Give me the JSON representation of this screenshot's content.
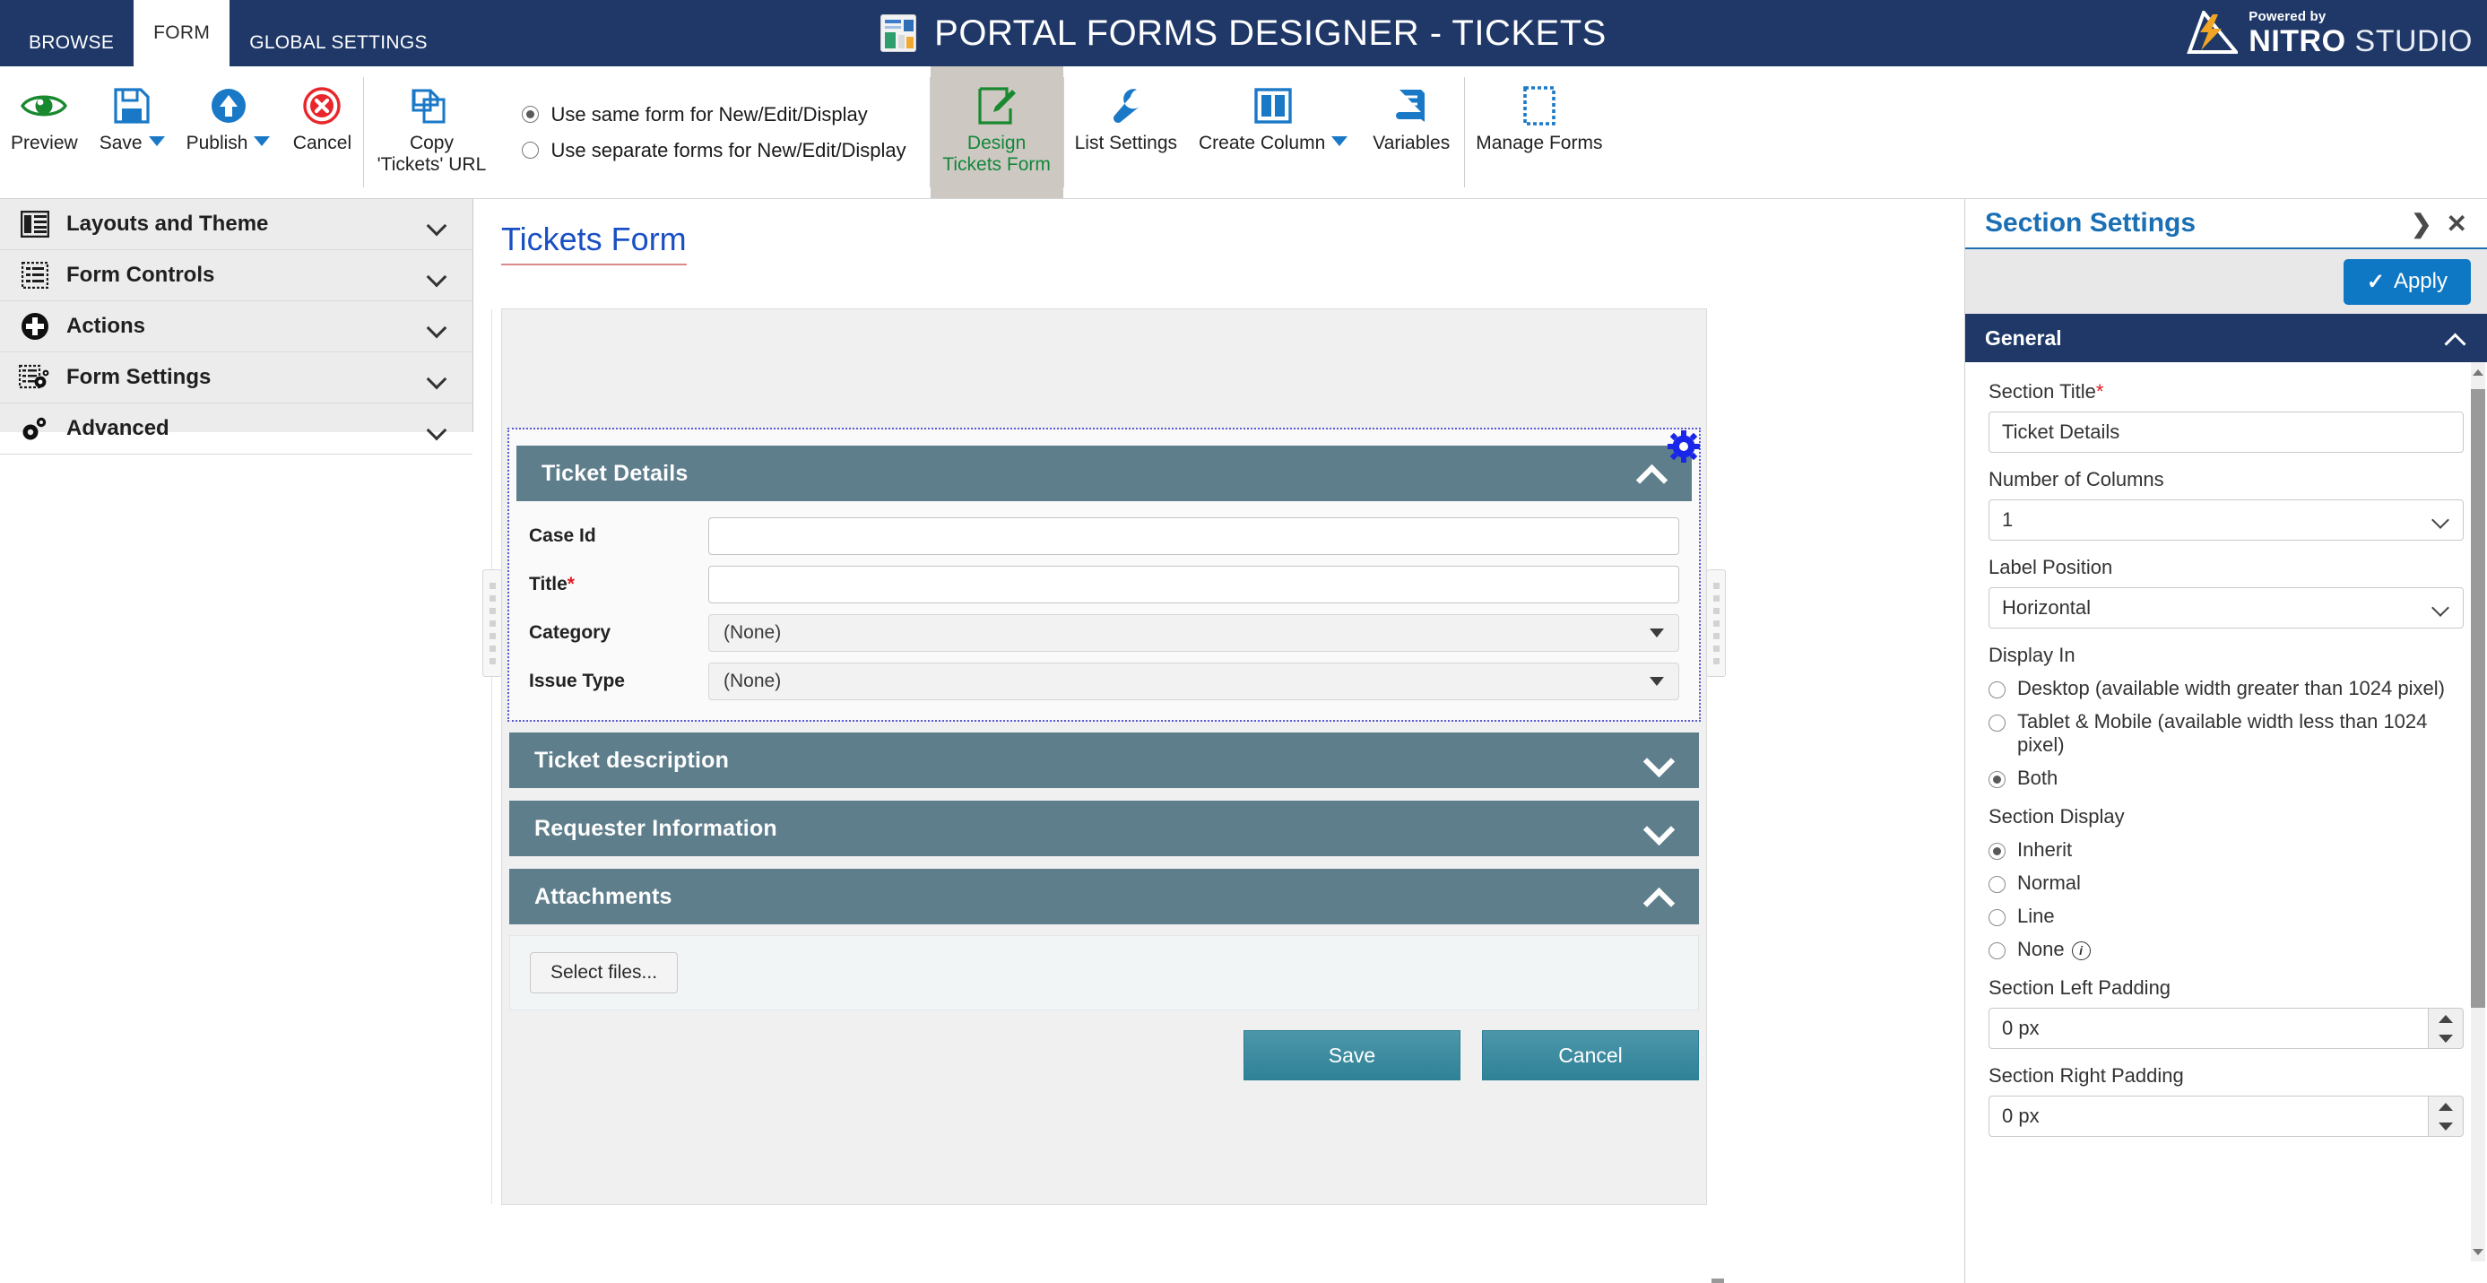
{
  "titlebar": {
    "tabs": [
      {
        "label": "BROWSE",
        "active": false
      },
      {
        "label": "FORM",
        "active": true
      },
      {
        "label": "GLOBAL SETTINGS",
        "active": false
      }
    ],
    "app_title": "PORTAL FORMS DESIGNER - TICKETS",
    "app_icon": "portal-forms-icon",
    "brand": {
      "powered_by": "Powered by",
      "name_bold": "NITRO",
      "name_light": "STUDIO",
      "accent": "#f2a524"
    },
    "bg_color": "#1f3868"
  },
  "ribbon": {
    "buttons": [
      {
        "label": "Preview",
        "icon": "eye-icon",
        "caret": false,
        "selected": false
      },
      {
        "label": "Save",
        "icon": "floppy-disk-icon",
        "caret": true,
        "selected": false
      },
      {
        "label": "Publish",
        "icon": "publish-up-arrow-icon",
        "caret": true,
        "selected": false
      },
      {
        "label": "Cancel",
        "icon": "cancel-circle-icon",
        "caret": false,
        "selected": false
      }
    ],
    "copy_url": {
      "icon": "copy-pages-icon",
      "line1": "Copy",
      "line2": "'Tickets' URL"
    },
    "form_mode": {
      "options": [
        {
          "label": "Use same form for New/Edit/Display",
          "checked": true
        },
        {
          "label": "Use separate forms for New/Edit/Display",
          "checked": false
        }
      ]
    },
    "design_button": {
      "icon": "design-pencil-icon",
      "line1": "Design",
      "line2": "Tickets Form",
      "selected": true
    },
    "tools": [
      {
        "label": "List Settings",
        "icon": "wrench-icon",
        "caret": false
      },
      {
        "label": "Create Column",
        "icon": "two-columns-icon",
        "caret": true
      },
      {
        "label": "Variables",
        "icon": "book-icon",
        "caret": false
      }
    ],
    "manage_forms": {
      "label": "Manage Forms",
      "icon": "dashed-rectangle-icon"
    }
  },
  "sidebar": {
    "items": [
      {
        "label": "Layouts and Theme",
        "icon": "layouts-icon"
      },
      {
        "label": "Form Controls",
        "icon": "form-controls-icon"
      },
      {
        "label": "Actions",
        "icon": "plus-circle-icon"
      },
      {
        "label": "Form Settings",
        "icon": "form-settings-gear-icon"
      },
      {
        "label": "Advanced",
        "icon": "advanced-gears-icon"
      }
    ]
  },
  "canvas": {
    "title": "Tickets Form",
    "sections": [
      {
        "title": "Ticket Details",
        "expanded": true,
        "selected": true,
        "gear": "section-settings-gear-icon",
        "fields": [
          {
            "label": "Case Id",
            "required": false,
            "type": "text",
            "value": ""
          },
          {
            "label": "Title",
            "required": true,
            "type": "text",
            "value": ""
          },
          {
            "label": "Category",
            "required": false,
            "type": "select",
            "value": "(None)"
          },
          {
            "label": "Issue Type",
            "required": false,
            "type": "select",
            "value": "(None)"
          }
        ]
      },
      {
        "title": "Ticket description",
        "expanded": false,
        "selected": false,
        "fields": []
      },
      {
        "title": "Requester Information",
        "expanded": false,
        "selected": false,
        "fields": []
      },
      {
        "title": "Attachments",
        "expanded": true,
        "selected": false,
        "fields": [],
        "select_files_label": "Select files..."
      }
    ],
    "actions": [
      {
        "label": "Save",
        "style": "teal"
      },
      {
        "label": "Cancel",
        "style": "teal"
      }
    ],
    "section_header_color": "#5e7e8c",
    "action_button_color": "#3a8a9e"
  },
  "right_panel": {
    "title": "Section Settings",
    "expand_icon": "chevron-right-icon",
    "close_icon": "close-x-icon",
    "apply_label": "Apply",
    "apply_icon": "check-icon",
    "accordion": {
      "label": "General",
      "expanded": true,
      "icon": "chevron-up-icon"
    },
    "fields": {
      "section_title_label": "Section Title",
      "section_title_required": "*",
      "section_title_value": "Ticket Details",
      "number_of_columns_label": "Number of Columns",
      "number_of_columns_value": "1",
      "label_position_label": "Label Position",
      "label_position_value": "Horizontal",
      "display_in_label": "Display In",
      "display_in_options": [
        {
          "label": "Desktop (available width greater than 1024 pixel)",
          "checked": false
        },
        {
          "label": "Tablet & Mobile (available width less than 1024 pixel)",
          "checked": false
        },
        {
          "label": "Both",
          "checked": true
        }
      ],
      "section_display_label": "Section Display",
      "section_display_options": [
        {
          "label": "Inherit",
          "checked": true,
          "info": false
        },
        {
          "label": "Normal",
          "checked": false,
          "info": false
        },
        {
          "label": "Line",
          "checked": false,
          "info": false
        },
        {
          "label": "None",
          "checked": false,
          "info": true
        }
      ],
      "section_left_padding_label": "Section Left Padding",
      "section_left_padding_value": "0 px",
      "section_right_padding_label": "Section Right Padding",
      "section_right_padding_value": "0 px"
    },
    "accent": "#1a6fb5",
    "header_color": "#1f3868"
  }
}
